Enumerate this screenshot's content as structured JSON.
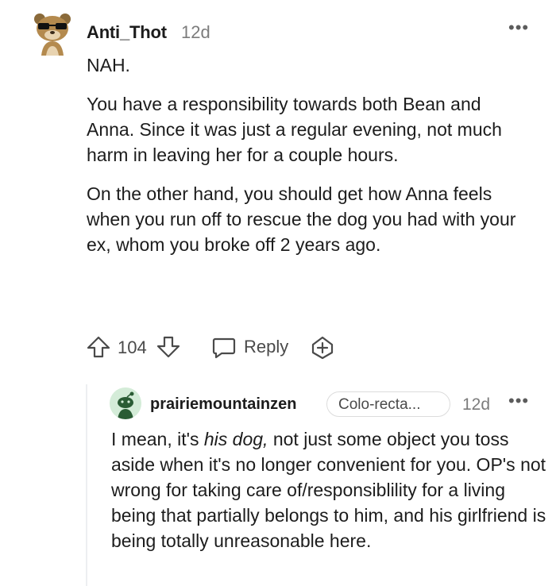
{
  "comment": {
    "username": "Anti_Thot",
    "age": "12d",
    "more": "•••",
    "paragraphs": [
      "NAH.",
      "You have a responsibility towards both Bean and Anna. Since it was just a regular evening, not much harm in leaving her for a couple hours.",
      "On the other hand, you should get how Anna feels when you run off to rescue the dog you had with your ex, whom you broke off 2 years ago."
    ],
    "actions": {
      "vote_count": "104",
      "reply_label": "Reply"
    }
  },
  "reply": {
    "username": "prairiemountainzen",
    "flair": "Colo-recta...",
    "age": "12d",
    "more": "•••",
    "body_before_em": "I mean, it's ",
    "body_em": "his dog,",
    "body_after_em": " not just some object you toss aside when it's no longer convenient for you. OP's not wrong for taking care of/responsiblility for a living being that partially belongs to him, and his girlfriend is being totally unreasonable here."
  },
  "colors": {
    "text": "#1c1c1c",
    "meta": "#7c7c7c",
    "action": "#4a4a4a",
    "thread_line": "#edeff1",
    "reply_avatar_bg": "#d4ecd8",
    "reply_avatar_fg": "#2a5c34"
  }
}
